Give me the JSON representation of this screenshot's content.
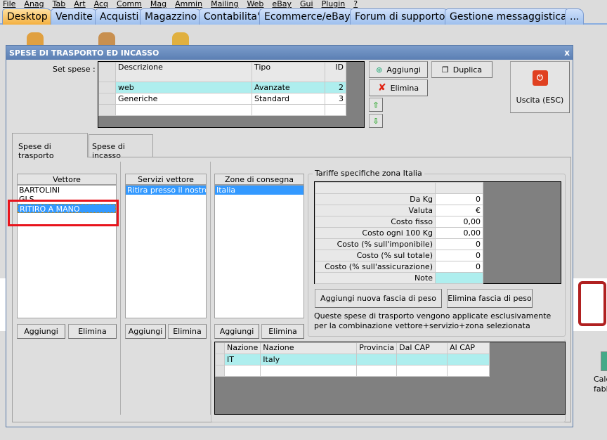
{
  "menu": [
    "File",
    "Anag",
    "Tab",
    "Art",
    "Acq",
    "Comm",
    "Mag",
    "Ammin",
    "Mailing",
    "Web",
    "eBay",
    "Gui",
    "Plugin",
    "?"
  ],
  "main_tabs": [
    {
      "label": "Desktop",
      "active": true
    },
    {
      "label": "Vendite"
    },
    {
      "label": "Acquisti"
    },
    {
      "label": "Magazzino"
    },
    {
      "label": "Contabilita'"
    },
    {
      "label": "Ecommerce/eBay"
    },
    {
      "label": "Forum di supporto"
    },
    {
      "label": "Gestione messaggistica"
    },
    {
      "label": "..."
    }
  ],
  "desktop_icons": {
    "right_label_1": "Calc",
    "right_label_2": "fabl"
  },
  "dialog": {
    "title": "SPESE DI TRASPORTO ED INCASSO",
    "close": "x",
    "set_spese_label": "Set spese :",
    "set_spese": {
      "headers": [
        "Descrizione",
        "Tipo",
        "ID"
      ],
      "rows": [
        [
          "web",
          "Avanzate",
          "2"
        ],
        [
          "Generiche",
          "Standard",
          "3"
        ]
      ]
    },
    "buttons": {
      "aggiungi": "Aggiungi",
      "duplica": "Duplica",
      "elimina": "Elimina",
      "uscita": "Uscita (ESC)"
    },
    "tabs": [
      "Spese di trasporto",
      "Spese di incasso"
    ],
    "vettore": {
      "header": "Vettore",
      "items": [
        "BARTOLINI",
        "GLS",
        "RITIRO A MANO"
      ],
      "selected": 2,
      "aggiungi": "Aggiungi",
      "elimina": "Elimina"
    },
    "servizi": {
      "header": "Servizi vettore",
      "items": [
        "Ritira presso il nostro punto"
      ],
      "selected": 0,
      "aggiungi": "Aggiungi",
      "elimina": "Elimina"
    },
    "zone": {
      "header": "Zone di consegna",
      "items": [
        "Italia"
      ],
      "selected": 0,
      "aggiungi": "Aggiungi",
      "elimina": "Elimina"
    },
    "tariffe": {
      "title": "Tariffe specifiche zona Italia",
      "rows": [
        [
          "Da Kg",
          "0"
        ],
        [
          "Valuta",
          "€"
        ],
        [
          "Costo fisso",
          "0,00"
        ],
        [
          "Costo ogni 100 Kg",
          "0,00"
        ],
        [
          "Costo (% sull'imponibile)",
          "0"
        ],
        [
          "Costo (% sul totale)",
          "0"
        ],
        [
          "Costo (% sull'assicurazione)",
          "0"
        ],
        [
          "Note",
          ""
        ]
      ],
      "add_button": "Aggiungi nuova fascia di peso",
      "del_button": "Elimina fascia di peso",
      "note": "Queste spese di trasporto vengono applicate esclusivamente per la combinazione vettore+servizio+zona selezionata"
    },
    "nazioni": {
      "headers": [
        "Nazione",
        "Nazione",
        "Provincia",
        "Dal CAP",
        "Al CAP"
      ],
      "rows": [
        [
          "IT",
          "Italy",
          "",
          "",
          ""
        ]
      ]
    }
  },
  "colors": {
    "selection": "#3399ff",
    "current_row": "#aeeeee",
    "highlight_box": "#e8141c",
    "title_bar": "#6a8ec0"
  }
}
